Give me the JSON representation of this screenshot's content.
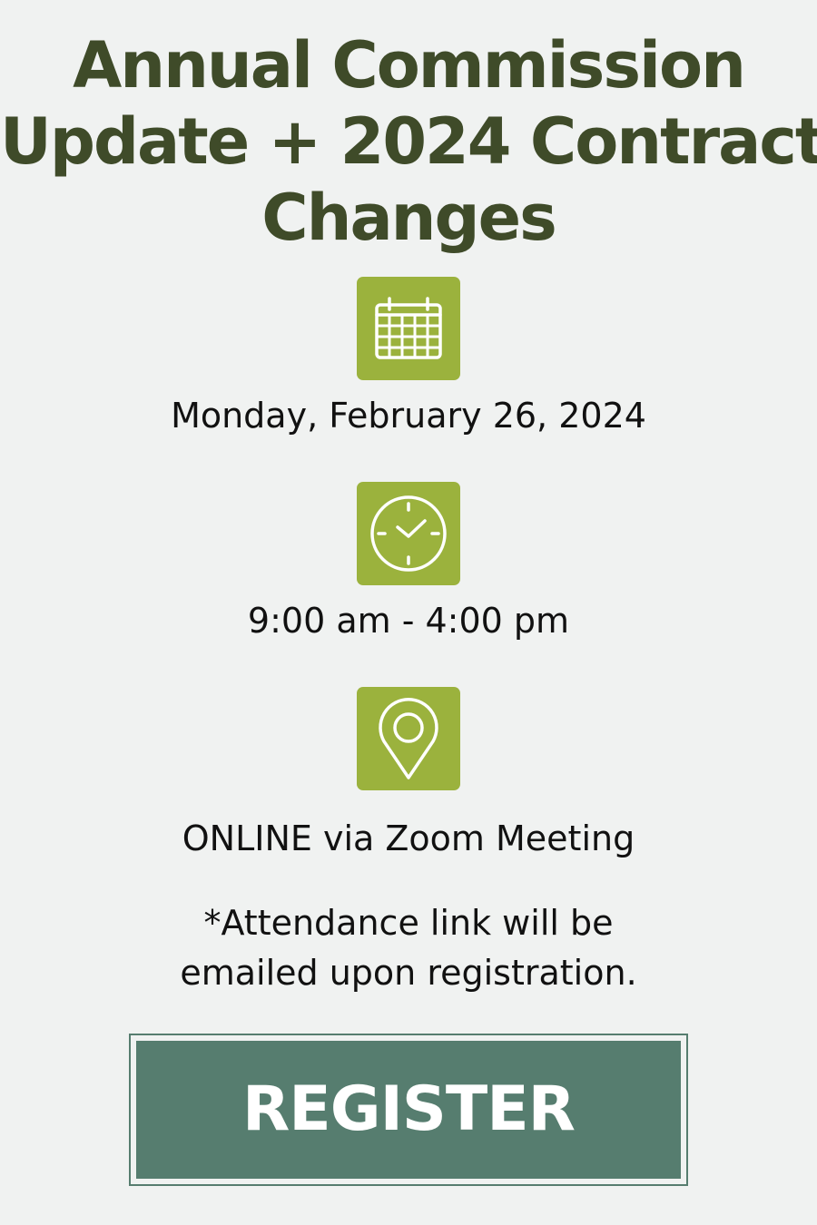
{
  "title": {
    "line1": "Annual Commission",
    "line2": "Update + 2024 Contract",
    "line3": "Changes"
  },
  "event": {
    "date": "Monday, February 26, 2024",
    "time": "9:00 am - 4:00 pm",
    "location": "ONLINE via Zoom Meeting"
  },
  "note": {
    "line1": "*Attendance link will be",
    "line2": "emailed upon registration."
  },
  "register": {
    "label": "REGISTER"
  },
  "icons": {
    "date": "calendar-icon",
    "time": "clock-icon",
    "location": "map-pin-icon"
  },
  "colors": {
    "background": "#f0f2f1",
    "title": "#3f4b29",
    "icon_tile": "#9bb23d",
    "button": "#567d6f",
    "text": "#111111"
  }
}
